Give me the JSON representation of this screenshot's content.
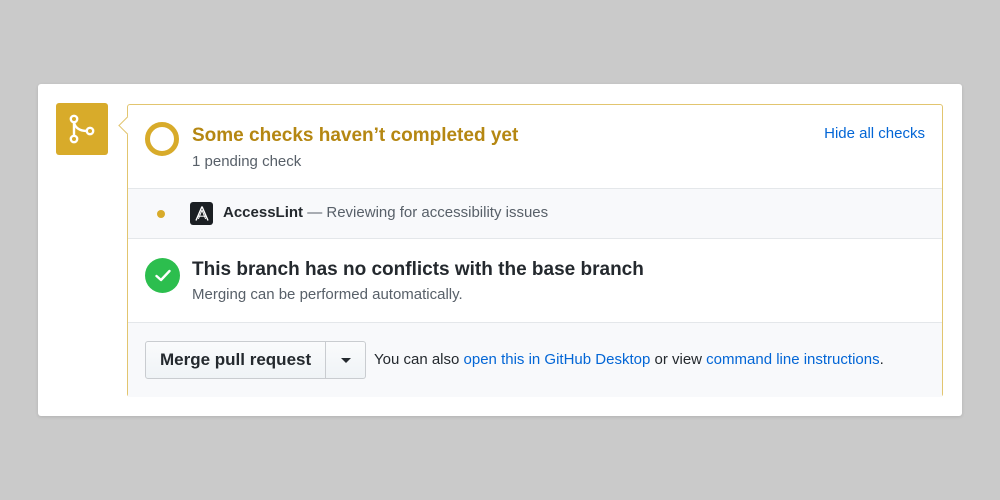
{
  "merge_icon": "git-merge-icon",
  "colors": {
    "pending": "#d8ab2a",
    "pending_text": "#b58712",
    "success": "#2cbe4e",
    "link": "#0366d6"
  },
  "checks": {
    "title": "Some checks haven’t completed yet",
    "subtitle": "1 pending check",
    "hide_link": "Hide all checks",
    "items": [
      {
        "status": "pending",
        "icon": "accesslint-logo-icon",
        "name": "AccessLint",
        "description": " — Reviewing for accessibility issues"
      }
    ]
  },
  "conflicts": {
    "title": "This branch has no conflicts with the base branch",
    "subtitle": "Merging can be performed automatically."
  },
  "merge": {
    "button_label": "Merge pull request",
    "note_prefix": "You can also ",
    "desktop_link": "open this in GitHub Desktop",
    "note_middle": " or view ",
    "cli_link": "command line instructions",
    "note_suffix": "."
  }
}
